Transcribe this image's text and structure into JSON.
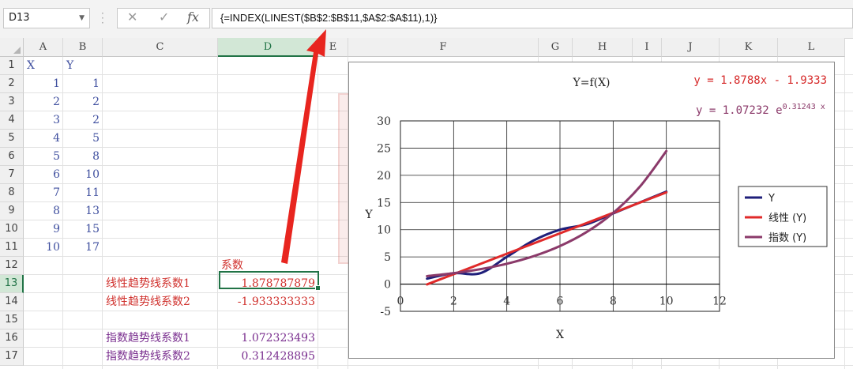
{
  "formula_bar": {
    "name_box": "D13",
    "cancel_icon": "✕",
    "enter_icon": "✓",
    "fx_label": "fx",
    "formula": "{=INDEX(LINEST($B$2:$B$11,$A$2:$A$11),1)}"
  },
  "columns": [
    "A",
    "B",
    "C",
    "D",
    "E",
    "F",
    "G",
    "H",
    "I",
    "J",
    "K",
    "L"
  ],
  "rows": [
    "1",
    "2",
    "3",
    "4",
    "5",
    "6",
    "7",
    "8",
    "9",
    "10",
    "11",
    "12",
    "13",
    "14",
    "15",
    "16",
    "17"
  ],
  "selected_column": "D",
  "selected_row": "13",
  "sheet": {
    "header_x": "X",
    "header_y": "Y",
    "x_values": [
      "1",
      "2",
      "3",
      "4",
      "5",
      "6",
      "7",
      "8",
      "9",
      "10"
    ],
    "y_values": [
      "1",
      "2",
      "2",
      "5",
      "8",
      "10",
      "11",
      "13",
      "15",
      "17"
    ],
    "coef_header": "系数",
    "labels": [
      {
        "text": "线性趋势线系数1",
        "value": "1.878787879",
        "color": "#d0312d",
        "row": 13
      },
      {
        "text": "线性趋势线系数2",
        "value": "-1.933333333",
        "color": "#d0312d",
        "row": 14
      },
      {
        "text": "指数趋势线系数1",
        "value": "1.072323493",
        "color": "#7a2f8f",
        "row": 16
      },
      {
        "text": "指数趋势线系数2",
        "value": "0.312428895",
        "color": "#7a2f8f",
        "row": 17
      }
    ]
  },
  "chart_data": {
    "type": "line",
    "title": "Y=f(X)",
    "xlabel": "X",
    "ylabel": "Y",
    "xlim": [
      0,
      12
    ],
    "ylim": [
      -5,
      30
    ],
    "x_ticks": [
      "0",
      "2",
      "4",
      "6",
      "8",
      "10",
      "12"
    ],
    "y_ticks": [
      "-5",
      "0",
      "5",
      "10",
      "15",
      "20",
      "25",
      "30"
    ],
    "grid": true,
    "legend_position": "right",
    "equation_linear": "y = 1.8788x - 1.9333",
    "equation_exp": "y = 1.07232 e",
    "equation_exp_power": "0.31243 x",
    "series": [
      {
        "name": "Y",
        "color": "#1f1f7a",
        "x": [
          1,
          2,
          3,
          4,
          5,
          6,
          7,
          8,
          9,
          10
        ],
        "values": [
          1,
          2,
          2,
          5,
          8,
          10,
          11,
          13,
          15,
          17
        ]
      },
      {
        "name": "线性 (Y)",
        "color": "#e02a2a",
        "x": [
          1,
          10
        ],
        "values": [
          -0.0545,
          16.8545
        ]
      },
      {
        "name": "指数 (Y)",
        "color": "#8b3a6a",
        "x": [
          1,
          2,
          3,
          4,
          5,
          6,
          7,
          8,
          9,
          10
        ],
        "values": [
          1.466,
          2.004,
          2.74,
          3.746,
          5.12,
          7.0,
          9.57,
          13.083,
          17.886,
          24.452
        ]
      }
    ]
  },
  "colors": {
    "selection": "#217346",
    "red_text": "#d0312d",
    "purple_text": "#7a2f8f",
    "blue_text": "#3f4f9f",
    "arrow": "#e8251f"
  }
}
